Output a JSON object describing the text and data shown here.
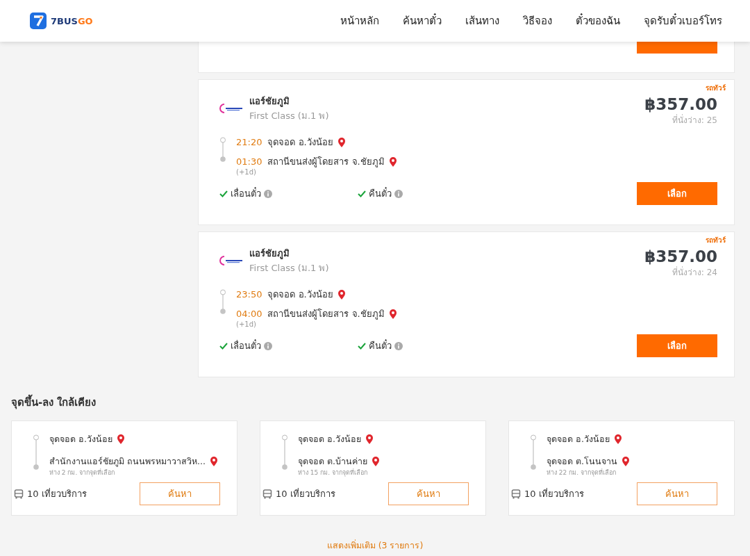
{
  "header": {
    "logo_main": "7BUS",
    "logo_accent": "GO",
    "nav": [
      {
        "label": "หน้าหลัก"
      },
      {
        "label": "ค้นหาตั๋ว"
      },
      {
        "label": "เส้นทาง"
      },
      {
        "label": "วิธีจอง"
      },
      {
        "label": "ตั๋วของฉัน"
      },
      {
        "label": "จุดรับตั๋วเบอร์โทร"
      }
    ]
  },
  "trips": [
    {
      "badge": "รถทัวร์",
      "operator": "แอร์ชัยภูมิ",
      "class": "First Class (ม.1 พ)",
      "price": "฿357.00",
      "seats": "ที่นั่งว่าง: 25",
      "depart_time": "21:20",
      "depart_place": "จุดจอด อ.วังน้อย",
      "arrive_time": "01:30",
      "arrive_place": "สถานีขนส่งผู้โดยสาร จ.ชัยภูมิ",
      "day_offset": "(+1d)",
      "features": [
        {
          "label": "เลื่อนตั๋ว",
          "available": true
        },
        {
          "label": "คืนตั๋ว",
          "available": true
        }
      ],
      "button": "เลือก"
    },
    {
      "badge": "รถทัวร์",
      "operator": "แอร์ชัยภูมิ",
      "class": "First Class (ม.1 พ)",
      "price": "฿357.00",
      "seats": "ที่นั่งว่าง: 24",
      "depart_time": "23:50",
      "depart_place": "จุดจอด อ.วังน้อย",
      "arrive_time": "04:00",
      "arrive_place": "สถานีขนส่งผู้โดยสาร จ.ชัยภูมิ",
      "day_offset": "(+1d)",
      "features": [
        {
          "label": "เลื่อนตั๋ว",
          "available": true
        },
        {
          "label": "คืนตั๋ว",
          "available": true
        }
      ],
      "button": "เลือก"
    }
  ],
  "nearby": {
    "title": "จุดขึ้น-ลง ใกล้เคียง",
    "cards": [
      {
        "from": "จุดจอด อ.วังน้อย",
        "to": "สำนักงานแอร์ชัยภูมิ ถนนพรหมาวาสวิห...",
        "distance": "ห่าง 2 กม. จากจุดที่เลือก",
        "trips": "10 เที่ยวบริการ",
        "button": "ค้นหา"
      },
      {
        "from": "จุดจอด อ.วังน้อย",
        "to": "จุดจอด ต.บ้านค่าย",
        "distance": "ห่าง 15 กม. จากจุดที่เลือก",
        "trips": "10 เที่ยวบริการ",
        "button": "ค้นหา"
      },
      {
        "from": "จุดจอด อ.วังน้อย",
        "to": "จุดจอด ต.โนนจาน",
        "distance": "ห่าง 22 กม. จากจุดที่เลือก",
        "trips": "10 เที่ยวบริการ",
        "button": "ค้นหา"
      }
    ],
    "show_more": "แสดงเพิ่มเติม (3 รายการ)"
  }
}
